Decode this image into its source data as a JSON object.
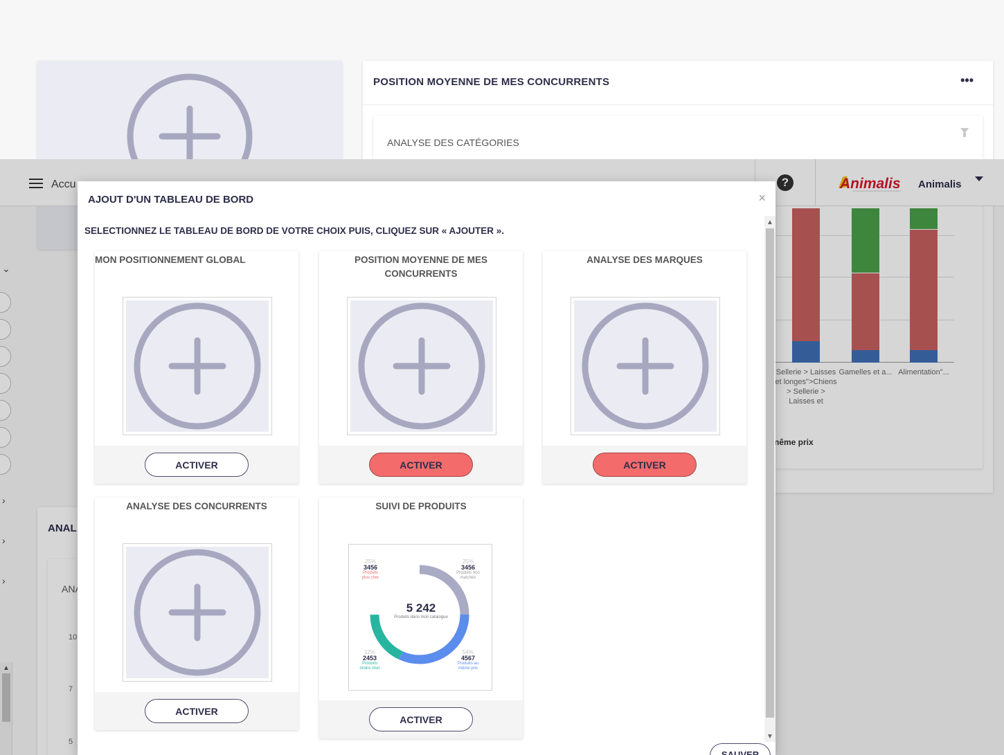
{
  "background": {
    "header": {
      "title": "Accu",
      "brand_name": "Animalis",
      "help_symbol": "?"
    },
    "right_panel": {
      "title": "POSITION MOYENNE DE MES CONCURRENTS",
      "menu_symbol": "•••",
      "subtitle": "ANALYSE DES CATÉGORIES",
      "footer_text": "nême prix"
    },
    "bottom_panel": {
      "title": "ANAL",
      "subtitle": "ANA",
      "ticks": [
        "10",
        "7",
        "5"
      ]
    },
    "chart_data": {
      "type": "bar",
      "categories": [
        "Sellerie > Laisses et longes\">Chiens > Sellerie > Laisses et",
        "Gamelles et a...",
        "Alimentation\"..."
      ],
      "series": [
        {
          "color": "#3e6fb5",
          "values": [
            14,
            8,
            8
          ]
        },
        {
          "color": "#c86060",
          "values": [
            86,
            50,
            78
          ]
        },
        {
          "color": "#4aa04a",
          "values": [
            0,
            42,
            14
          ]
        }
      ]
    }
  },
  "modal": {
    "title": "AJOUT D'UN TABLEAU DE BORD",
    "close_symbol": "×",
    "instruction": "SELECTIONNEZ LE TABLEAU DE BORD DE VOTRE CHOIX PUIS, CLIQUEZ SUR « AJOUTER ».",
    "save_label": "SAUVER",
    "cards": [
      {
        "title": "MON POSITIONNEMENT GLOBAL",
        "button": "ACTIVER",
        "active": false
      },
      {
        "title": "POSITION MOYENNE DE MES CONCURRENTS",
        "button": "ACTIVER",
        "active": true
      },
      {
        "title": "ANALYSE DES MARQUES",
        "button": "ACTIVER",
        "active": true
      },
      {
        "title": "ANALYSE DES CONCURRENTS",
        "button": "ACTIVER",
        "active": false
      },
      {
        "title": "SUIVI DE PRODUITS",
        "button": "ACTIVER",
        "active": false
      }
    ],
    "donut": {
      "total": "5 242",
      "total_caption": "Produits dans mon catalogue",
      "segments": [
        {
          "pct": "25%",
          "value": "3456",
          "caption": "Produits plus cher",
          "color": "#f36b6b"
        },
        {
          "pct": "25%",
          "value": "3456",
          "caption": "Produits non matchés",
          "color": "#a9aac3"
        },
        {
          "pct": "54%",
          "value": "4567",
          "caption": "Produits au même prix",
          "color": "#5b8def"
        },
        {
          "pct": "12%",
          "value": "2453",
          "caption": "Produits moins cher",
          "color": "#28b5a0"
        }
      ]
    }
  }
}
